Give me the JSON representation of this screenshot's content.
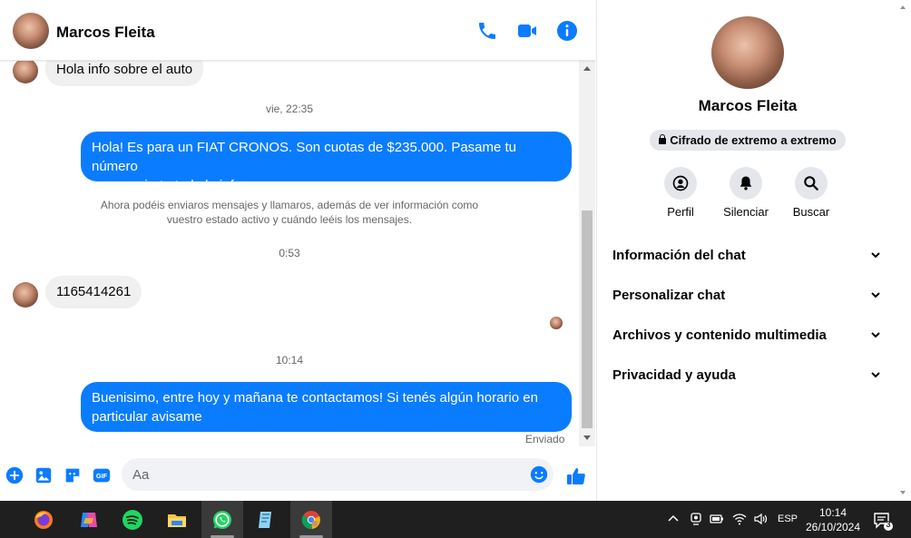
{
  "chat": {
    "contact_name": "Marcos Fleita",
    "header_icons": [
      "phone-icon",
      "video-camera-icon",
      "info-icon"
    ],
    "messages": [
      {
        "direction": "incoming",
        "text": "Hola info sobre el auto"
      },
      {
        "type": "timestamp",
        "text": "vie, 22:35"
      },
      {
        "direction": "outgoing",
        "line1": "Hola! Es para un FIAT CRONOS. Son cuotas de $235.000. Pasame tu número",
        "line2": "para enviarte toda la info"
      },
      {
        "type": "system",
        "line1": "Ahora podéis enviaros mensajes y llamaros, además de ver información como",
        "line2": "vuestro estado activo y cuándo leéis los mensajes."
      },
      {
        "type": "timestamp",
        "text": "0:53"
      },
      {
        "direction": "incoming",
        "text": "1165414261"
      },
      {
        "type": "timestamp",
        "text": "10:14"
      },
      {
        "direction": "outgoing",
        "line1": "Buenisimo, entre hoy y mañana te contactamos! Si tenés algún horario en",
        "line2": "particular avisame"
      }
    ],
    "status": "Enviado",
    "composer": {
      "placeholder": "Aa",
      "icons": [
        "plus-icon",
        "image-icon",
        "sticker-icon",
        "gif-icon",
        "emoji-icon",
        "thumbs-up-icon"
      ]
    }
  },
  "info_panel": {
    "name": "Marcos Fleita",
    "encryption_badge": "Cifrado de extremo a extremo",
    "actions": [
      {
        "label": "Perfil",
        "icon": "profile-icon"
      },
      {
        "label": "Silenciar",
        "icon": "bell-icon"
      },
      {
        "label": "Buscar",
        "icon": "search-icon"
      }
    ],
    "sections": [
      {
        "title": "Información del chat"
      },
      {
        "title": "Personalizar chat"
      },
      {
        "title": "Archivos y contenido multimedia"
      },
      {
        "title": "Privacidad y ayuda"
      }
    ]
  },
  "taskbar": {
    "apps": [
      "firefox-icon",
      "copilot-icon",
      "spotify-icon",
      "file-explorer-icon",
      "whatsapp-icon",
      "notes-app-icon",
      "chrome-icon"
    ],
    "language": "ESP",
    "time": "10:14",
    "date": "26/10/2024",
    "notification_count": "3"
  },
  "colors": {
    "accent": "#0a7cff",
    "incoming_bubble": "#f0f0f0",
    "taskbar": "#1f1f1f"
  }
}
